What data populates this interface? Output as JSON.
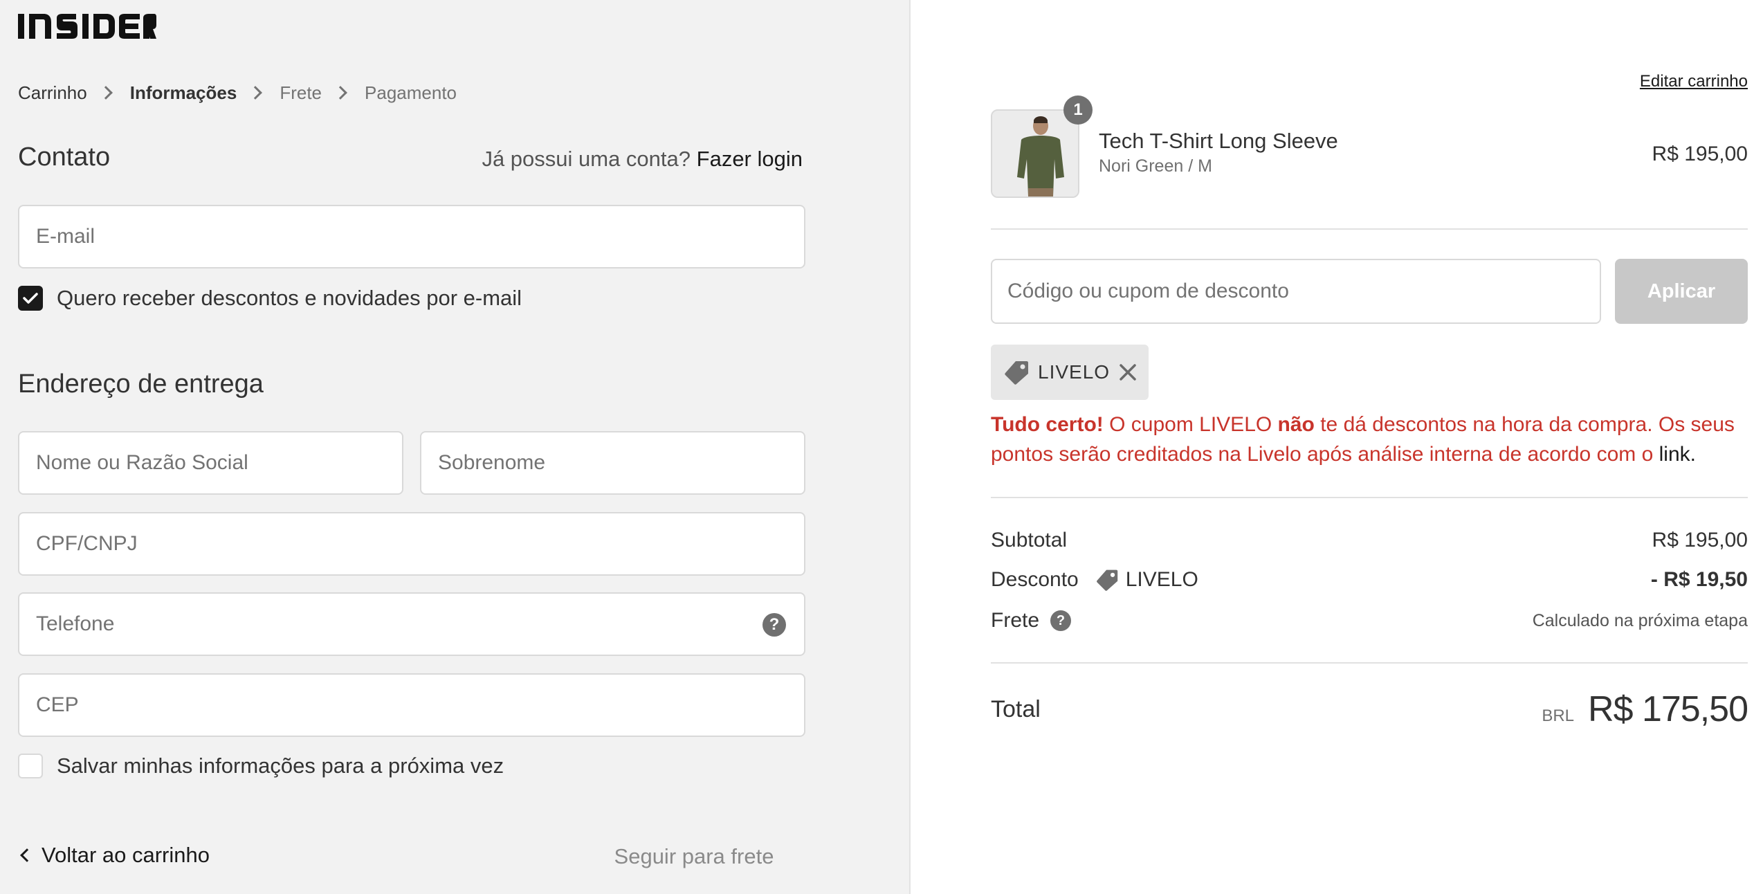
{
  "brand": {
    "logo_text": "INSIDER"
  },
  "breadcrumb": [
    {
      "label": "Carrinho",
      "state": "link"
    },
    {
      "label": "Informações",
      "state": "current"
    },
    {
      "label": "Frete",
      "state": "muted"
    },
    {
      "label": "Pagamento",
      "state": "muted"
    }
  ],
  "contact": {
    "title": "Contato",
    "login_prompt": "Já possui uma conta?",
    "login_link": "Fazer login",
    "email_placeholder": "E-mail",
    "newsletter_label": "Quero receber descontos e novidades por e-mail",
    "newsletter_checked": true
  },
  "shipping": {
    "title": "Endereço de entrega",
    "first_name_placeholder": "Nome ou Razão Social",
    "last_name_placeholder": "Sobrenome",
    "document_placeholder": "CPF/CNPJ",
    "phone_placeholder": "Telefone",
    "zip_placeholder": "CEP",
    "save_info_label": "Salvar minhas informações para a próxima vez",
    "save_info_checked": false
  },
  "footer_nav": {
    "back_label": "Voltar ao carrinho",
    "next_label": "Seguir para frete"
  },
  "cart": {
    "edit_label": "Editar carrinho",
    "item": {
      "quantity": "1",
      "name": "Tech T-Shirt Long Sleeve",
      "variant": "Nori Green / M",
      "price": "R$ 195,00"
    }
  },
  "coupon": {
    "placeholder": "Código ou cupom de desconto",
    "apply_label": "Aplicar",
    "applied_code": "LIVELO",
    "notice_strong": "Tudo certo!",
    "notice_part1": " O cupom LIVELO ",
    "notice_bold2": "não",
    "notice_part2": " te dá descontos na hora da compra. Os seus pontos serão creditados na Livelo após análise interna de acordo com o ",
    "notice_link": "link."
  },
  "summary": {
    "subtotal_label": "Subtotal",
    "subtotal_value": "R$ 195,00",
    "discount_label": "Desconto",
    "discount_code": "LIVELO",
    "discount_value": "- R$ 19,50",
    "shipping_label": "Frete",
    "shipping_value": "Calculado na próxima etapa",
    "total_label": "Total",
    "currency": "BRL",
    "total_value": "R$ 175,50"
  },
  "colors": {
    "accent_dark": "#1a1a1a",
    "notice_red": "#c8342b",
    "left_panel_bg": "#f2f2f2",
    "disabled_button": "#c8c8c8"
  }
}
